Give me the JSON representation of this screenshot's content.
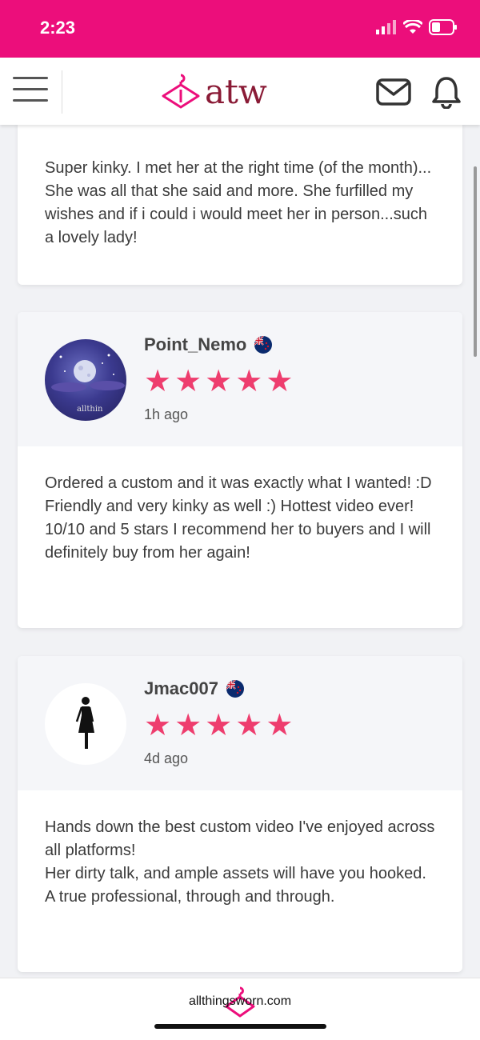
{
  "status_bar": {
    "time": "2:23",
    "icons": [
      "signal-icon",
      "wifi-icon",
      "battery-icon"
    ]
  },
  "nav": {
    "logo_text": "atw",
    "icons": [
      "menu-icon",
      "hanger-icon",
      "mail-icon",
      "bell-icon"
    ]
  },
  "colors": {
    "brand_pink": "#ec0e7b",
    "logo_maroon": "#8a1b36",
    "star": "#ee3d6e"
  },
  "reviews": [
    {
      "text": "Super kinky. I met her at the right time (of the month)... She was all that she said and more. She furfilled my wishes and if i could i would meet her in person...such a lovely lady!"
    },
    {
      "username": "Point_Nemo",
      "flag": "nz-flag-icon",
      "rating": 5,
      "time_ago": "1h ago",
      "avatar_watermark": "allthin",
      "text": "Ordered a custom and it was exactly what I wanted! :D Friendly and very kinky as well :) Hottest video ever! 10/10 and 5 stars I recommend her to buyers and I will definitely buy from her again!"
    },
    {
      "username": "Jmac007",
      "flag": "nz-flag-icon",
      "rating": 5,
      "time_ago": "4d ago",
      "text_lines": [
        "Hands down the best custom video I've enjoyed across all platforms!",
        "Her dirty talk, and ample assets will have you hooked.",
        "A true professional, through and through."
      ]
    }
  ],
  "footer": {
    "text": "allthingsworn.com"
  }
}
